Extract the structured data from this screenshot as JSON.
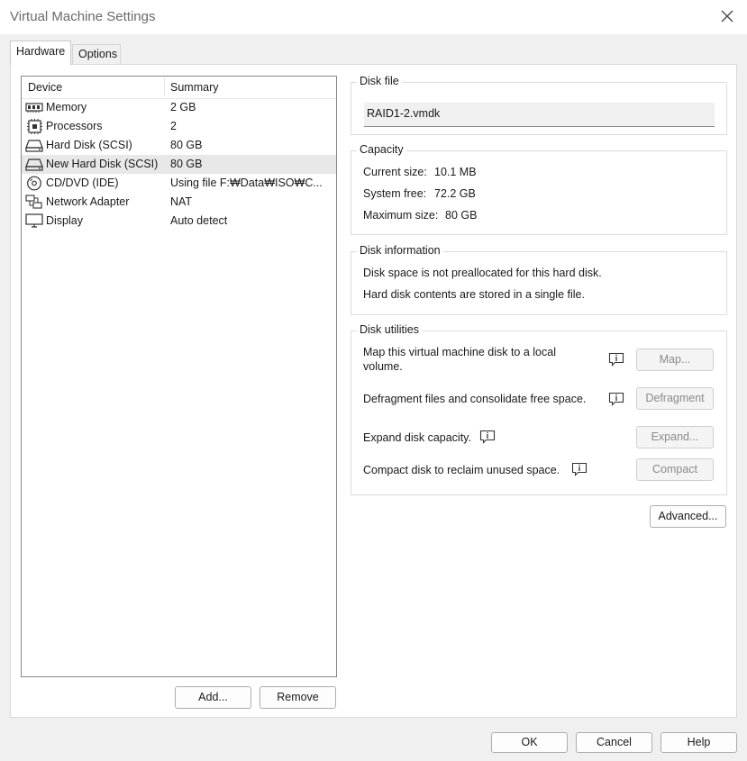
{
  "window": {
    "title": "Virtual Machine Settings"
  },
  "tabs": [
    {
      "label": "Hardware"
    },
    {
      "label": "Options"
    }
  ],
  "device_list": {
    "headers": {
      "device": "Device",
      "summary": "Summary"
    },
    "rows": [
      {
        "icon": "memory-icon",
        "name": "Memory",
        "summary": "2 GB"
      },
      {
        "icon": "processor-icon",
        "name": "Processors",
        "summary": "2"
      },
      {
        "icon": "hard-disk-icon",
        "name": "Hard Disk (SCSI)",
        "summary": "80 GB"
      },
      {
        "icon": "hard-disk-icon",
        "name": "New Hard Disk (SCSI)",
        "summary": "80 GB",
        "selected": true
      },
      {
        "icon": "cd-dvd-icon",
        "name": "CD/DVD (IDE)",
        "summary": "Using file F:₩Data₩ISO₩C..."
      },
      {
        "icon": "network-adapter-icon",
        "name": "Network Adapter",
        "summary": "NAT"
      },
      {
        "icon": "display-icon",
        "name": "Display",
        "summary": "Auto detect"
      }
    ]
  },
  "buttons": {
    "add": "Add...",
    "remove": "Remove",
    "ok": "OK",
    "cancel": "Cancel",
    "help": "Help"
  },
  "disk_file": {
    "legend": "Disk file",
    "value": "RAID1-2.vmdk"
  },
  "capacity": {
    "legend": "Capacity",
    "current_label": "Current size:",
    "current_value": "10.1 MB",
    "free_label": "System free:",
    "free_value": "72.2 GB",
    "max_label": "Maximum size:",
    "max_value": "80 GB"
  },
  "disk_information": {
    "legend": "Disk information",
    "line1": "Disk space is not preallocated for this hard disk.",
    "line2": "Hard disk contents are stored in a single file."
  },
  "disk_utilities": {
    "legend": "Disk utilities",
    "map_text_1": "Map this virtual machine disk to a local",
    "map_text_2": "volume.",
    "map_button": "Map...",
    "defrag_text": "Defragment files and consolidate free space.",
    "defrag_button": "Defragment",
    "expand_text": "Expand disk capacity.",
    "expand_button": "Expand...",
    "compact_text": "Compact disk to reclaim unused space.",
    "compact_button": "Compact"
  },
  "advanced_button": "Advanced...",
  "colors": {
    "selected_row": "#e8e8e8",
    "disabled_text": "#8a8a8a"
  }
}
